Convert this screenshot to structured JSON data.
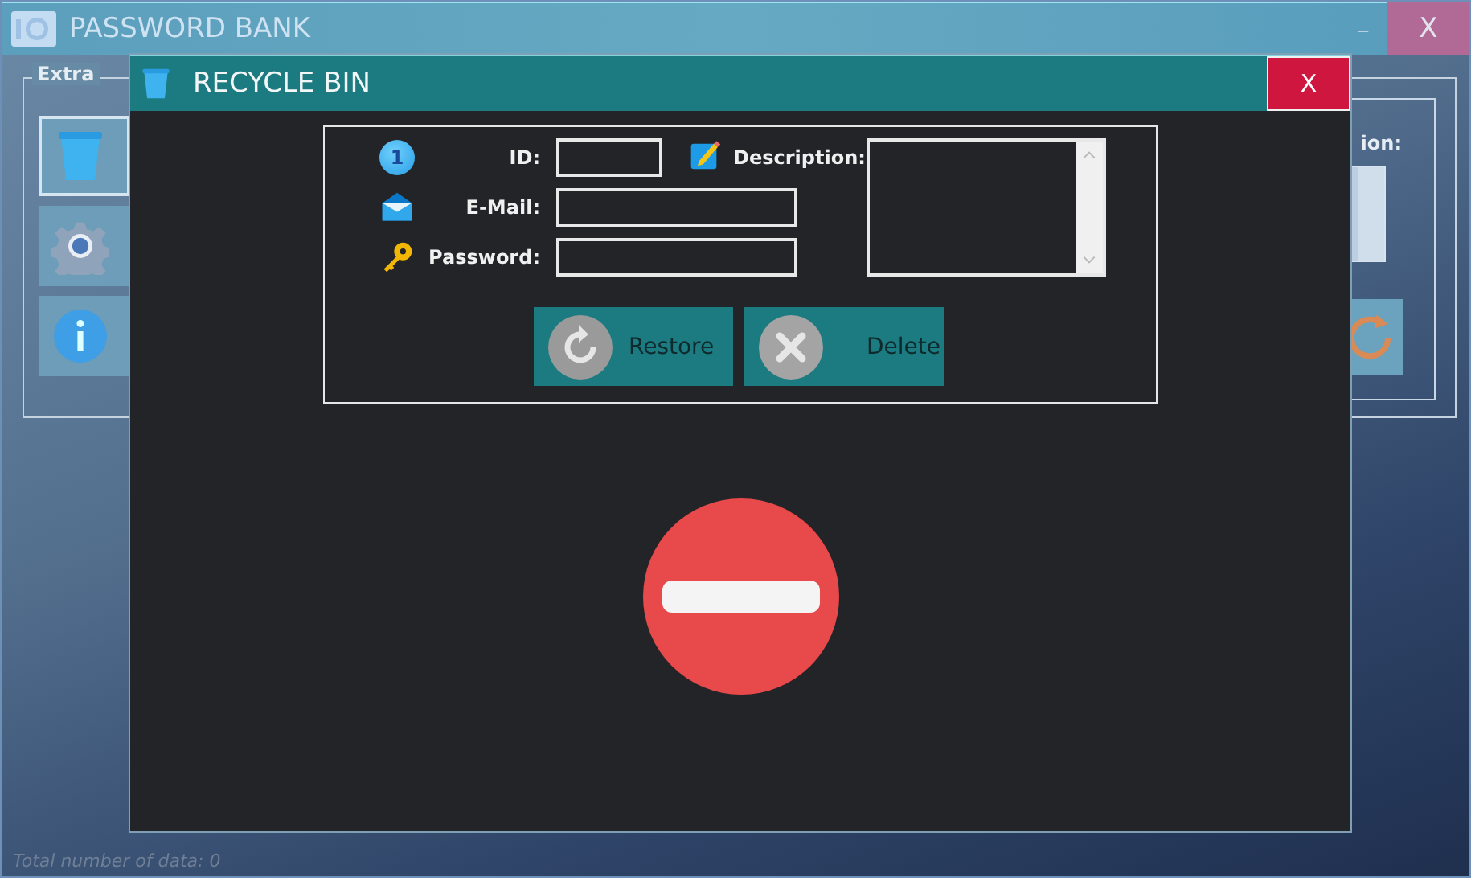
{
  "main_window": {
    "title": "PASSWORD BANK",
    "minimize": "_",
    "close": "X",
    "group": {
      "title": "Extra",
      "tools": [
        {
          "kind": "trash"
        },
        {
          "kind": "settings"
        },
        {
          "kind": "info"
        }
      ]
    },
    "partial_label": "ion:",
    "status_bar": "Total number of data: 0"
  },
  "dialog": {
    "title": "RECYCLE BIN",
    "close": "X",
    "fields": [
      {
        "label": "ID:",
        "kind": "id",
        "badge": "1"
      },
      {
        "label": "E-Mail:",
        "kind": "email"
      },
      {
        "label": "Password:",
        "kind": "password"
      }
    ],
    "description": {
      "label": "Description:"
    },
    "buttons": [
      {
        "label": "Restore",
        "kind": "restore"
      },
      {
        "label": "Delete",
        "kind": "delete"
      }
    ]
  }
}
